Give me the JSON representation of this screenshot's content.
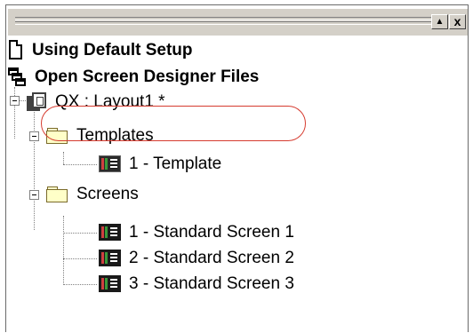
{
  "titlebar": {
    "scroll_up_label": "▲",
    "close_label": "x"
  },
  "tree": {
    "items": [
      {
        "label": "Using Default Setup",
        "icon": "document-icon"
      },
      {
        "label": "Open Screen Designer Files",
        "icon": "windows-icon"
      },
      {
        "label": "QX : Layout1 *",
        "icon": "layout-icon"
      },
      {
        "label": "Templates",
        "icon": "folder-icon"
      },
      {
        "label": "1 - Template",
        "icon": "template-icon"
      },
      {
        "label": "Screens",
        "icon": "folder-icon"
      },
      {
        "label": "1 - Standard Screen 1",
        "icon": "screen-icon"
      },
      {
        "label": "2 - Standard Screen 2",
        "icon": "screen-icon"
      },
      {
        "label": "3 - Standard Screen 3",
        "icon": "screen-icon"
      }
    ]
  },
  "colors": {
    "callout": "#d63b2f",
    "folder": "#ffffc8",
    "template_bar_red": "#d04040",
    "template_bar_green": "#3a9a3a"
  }
}
